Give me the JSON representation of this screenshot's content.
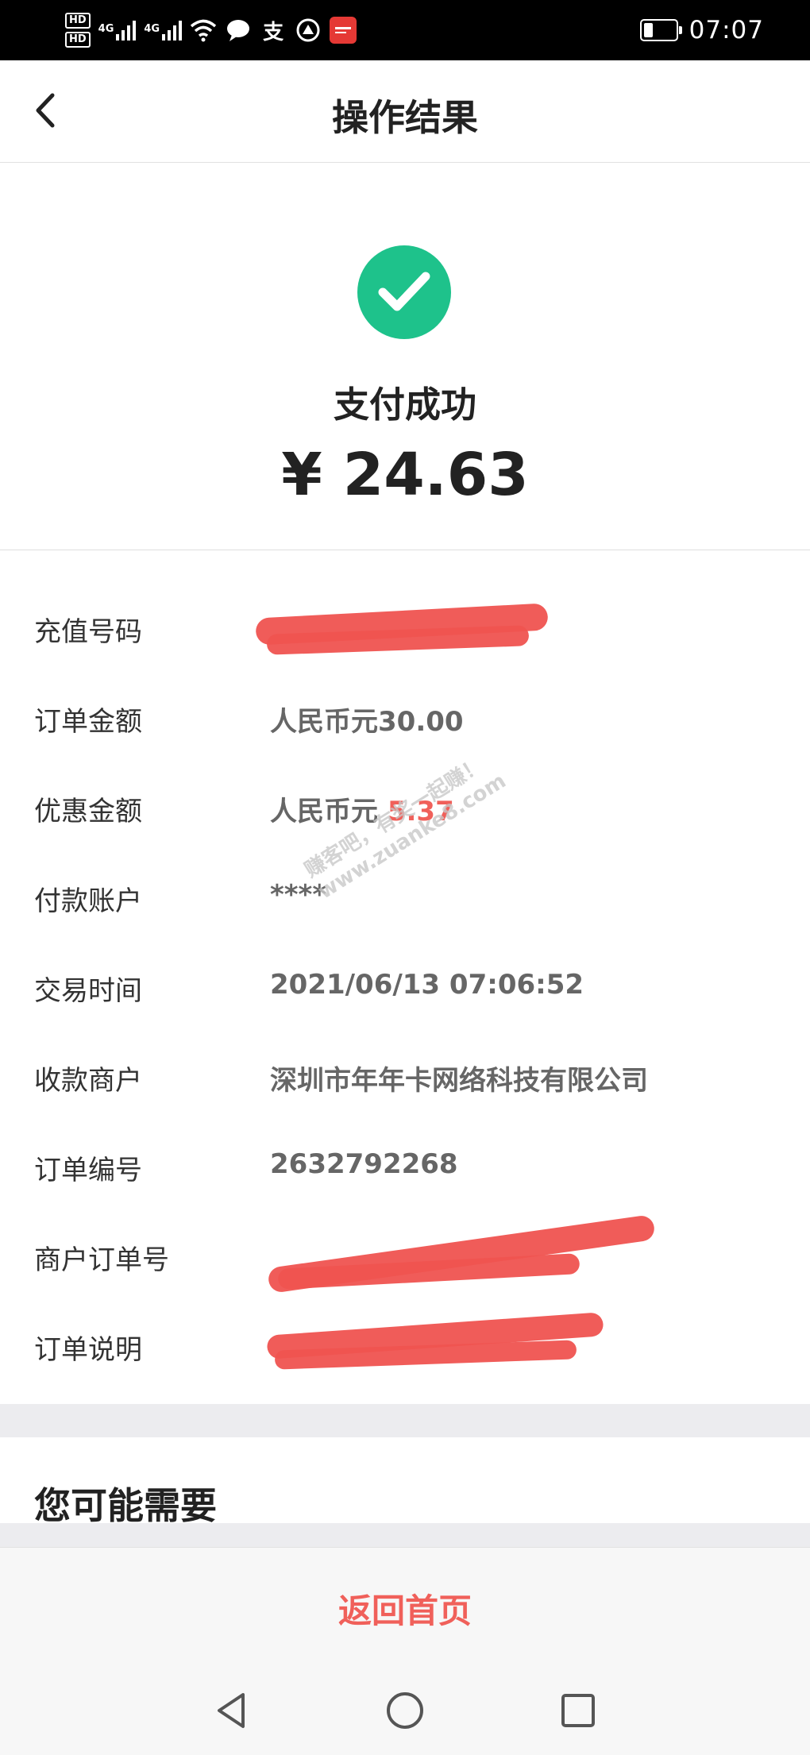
{
  "status_bar": {
    "hd_1": "HD",
    "hd_2": "HD",
    "net_1": "4G",
    "net_2": "4G",
    "alipay_glyph": "支",
    "time": "07:07",
    "battery_level": 0.3,
    "icons": [
      "hd-badge",
      "signal-icon",
      "wifi-icon",
      "chat-icon",
      "alipay-icon",
      "app-icon",
      "battery-icon"
    ]
  },
  "header": {
    "title": "操作结果",
    "back_icon": "back-arrow-icon"
  },
  "result": {
    "status_icon": "check-circle-icon",
    "status_color": "#1ec28b",
    "status_text": "支付成功",
    "currency_symbol": "¥",
    "amount": "24.63"
  },
  "details": [
    {
      "label": "充值号码",
      "value": ""
    },
    {
      "label": "订单金额",
      "value": "人民币元30.00"
    },
    {
      "label": "优惠金额",
      "value_prefix": "人民币元 ",
      "value_highlight": "5.37"
    },
    {
      "label": "付款账户",
      "value": "****"
    },
    {
      "label": "交易时间",
      "value": "2021/06/13 07:06:52"
    },
    {
      "label": "收款商户",
      "value": "深圳市年年卡网络科技有限公司"
    },
    {
      "label": "订单编号",
      "value": "2632792268"
    },
    {
      "label": "商户订单号",
      "value": ""
    },
    {
      "label": "订单说明",
      "value": ""
    }
  ],
  "watermark": {
    "line_1": "赚客吧，有奖一起赚！",
    "line_2": "www.zuanke8.com"
  },
  "recommend": {
    "title": "您可能需要"
  },
  "bottom": {
    "home_button": "返回首页",
    "accent_color": "#f0605a"
  },
  "system_nav": {
    "icons": [
      "back-triangle-icon",
      "home-circle-icon",
      "recents-square-icon"
    ]
  }
}
